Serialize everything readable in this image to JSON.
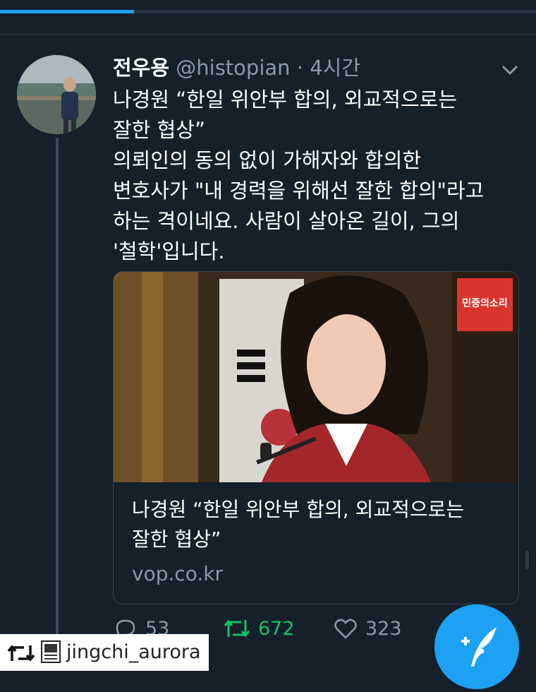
{
  "tweet": {
    "author": "전우용",
    "handle": "@histopian",
    "time": "4시간",
    "body_lines": [
      "나경원 “한일 위안부 합의, 외교적으로는",
      "잘한 협상”",
      "의뢰인의 동의 없이 가해자와 합의한",
      "변호사가 \"내 경력을 위해선 잘한 합의\"라고",
      "하는 격이네요. 사람이 살아온 길이, 그의",
      "'철학'입니다."
    ]
  },
  "card": {
    "badge": "민중의소리",
    "title_lines": [
      "나경원 “한일 위안부 합의, 외교적으로는",
      "잘한 협상”"
    ],
    "domain": "vop.co.kr"
  },
  "actions": {
    "replies": "53",
    "retweets": "672",
    "likes": "323"
  },
  "footer": {
    "username": "jingchi_aurora"
  },
  "colors": {
    "background": "#15202b",
    "accent": "#1da1f2",
    "retweet": "#17bf63"
  }
}
